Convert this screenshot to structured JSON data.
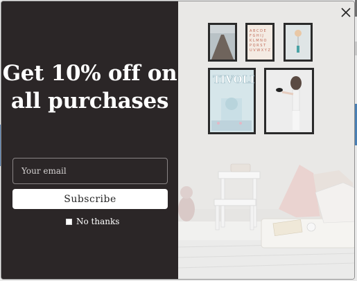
{
  "popup": {
    "headline": "Get 10% off on all purchases",
    "email_placeholder": "Your email",
    "subscribe_label": "Subscribe",
    "no_thanks_label": "No thanks",
    "close_icon": "close-icon",
    "image_alt": "white room with framed posters, step stool and floor cushions"
  },
  "poster": {
    "alphabet_text": "A B C D E F G H I J K L M N O P Q R S T U V W X Y Z",
    "city_text": "TIVOLI"
  },
  "colors": {
    "panel": "#2b2627",
    "text": "#ffffff",
    "button_bg": "#ffffff",
    "input_border": "#8a8586"
  }
}
